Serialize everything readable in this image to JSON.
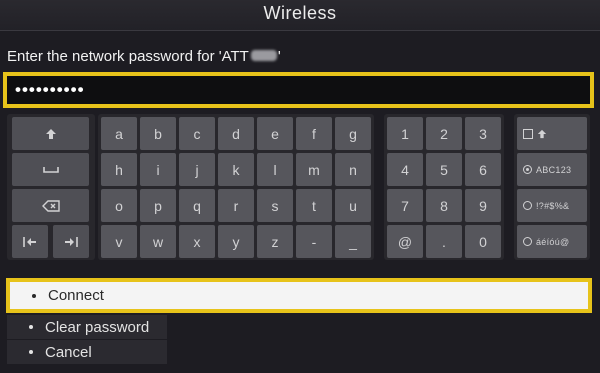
{
  "header": {
    "title": "Wireless"
  },
  "prompt": {
    "before": "Enter the network password for 'ATT",
    "after": "'"
  },
  "password": {
    "masked": "••••••••••"
  },
  "keyboard": {
    "letters": [
      [
        "a",
        "b",
        "c",
        "d",
        "e",
        "f",
        "g"
      ],
      [
        "h",
        "i",
        "j",
        "k",
        "l",
        "m",
        "n"
      ],
      [
        "o",
        "p",
        "q",
        "r",
        "s",
        "t",
        "u"
      ],
      [
        "v",
        "w",
        "x",
        "y",
        "z",
        "-",
        "_"
      ]
    ],
    "numbers": [
      [
        "1",
        "2",
        "3"
      ],
      [
        "4",
        "5",
        "6"
      ],
      [
        "7",
        "8",
        "9"
      ],
      [
        "@",
        ".",
        "0"
      ]
    ],
    "modes": {
      "shift_icon": "shift-arrow-icon",
      "abc": "ABC123",
      "symbols": "!?#$%&",
      "accents": "áéíóú@"
    },
    "controls": [
      "shift-arrow-icon",
      "space-icon",
      "backspace-icon",
      "cursor-left-icon",
      "cursor-right-icon"
    ]
  },
  "actions": {
    "connect": "Connect",
    "clear": "Clear password",
    "cancel": "Cancel"
  },
  "colors": {
    "focus": "#e7c31a",
    "background": "#1d1c22",
    "key": "#56565c"
  }
}
